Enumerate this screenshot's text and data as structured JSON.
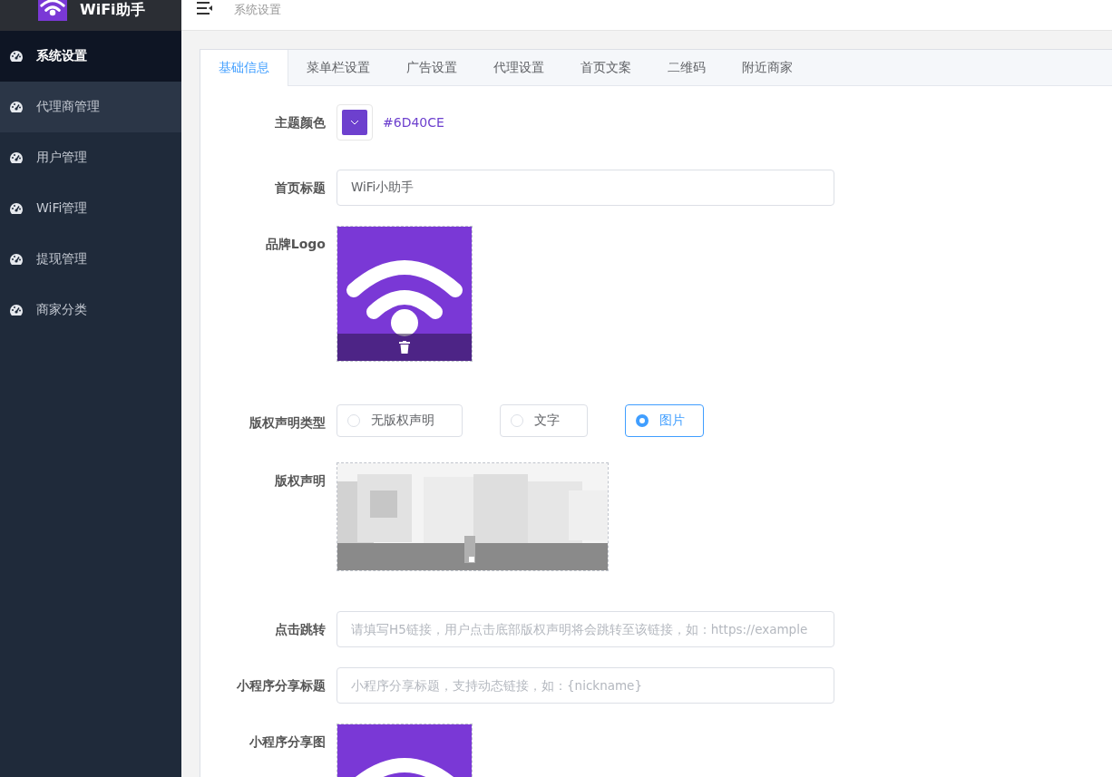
{
  "sidebar": {
    "brand": "WiFi助手",
    "items": [
      {
        "label": "系统设置",
        "selected": true,
        "hovered": false
      },
      {
        "label": "代理商管理",
        "selected": false,
        "hovered": true
      },
      {
        "label": "用户管理",
        "selected": false,
        "hovered": false
      },
      {
        "label": "WiFi管理",
        "selected": false,
        "hovered": false
      },
      {
        "label": "提现管理",
        "selected": false,
        "hovered": false
      },
      {
        "label": "商家分类",
        "selected": false,
        "hovered": false
      }
    ]
  },
  "breadcrumb": "系统设置",
  "tabs": [
    {
      "label": "基础信息",
      "selected": true
    },
    {
      "label": "菜单栏设置",
      "selected": false
    },
    {
      "label": "广告设置",
      "selected": false
    },
    {
      "label": "代理设置",
      "selected": false
    },
    {
      "label": "首页文案",
      "selected": false
    },
    {
      "label": "二维码",
      "selected": false
    },
    {
      "label": "附近商家",
      "selected": false
    }
  ],
  "form": [
    {
      "kind": "color",
      "label": "主题颜色",
      "value": "#6D40CE"
    },
    {
      "kind": "text",
      "label": "首页标题",
      "value": "WiFi小助手"
    },
    {
      "label": "品牌Logo",
      "delete_button": true
    },
    {
      "kind": "radio",
      "label": "版权声明类型",
      "options": [
        {
          "label": "无版权声明",
          "selected": false
        },
        {
          "label": "文字",
          "selected": false
        },
        {
          "label": "图片",
          "selected": true
        }
      ]
    },
    {
      "kind": "picture",
      "label": "版权声明"
    },
    {
      "kind": "input",
      "label": "点击跳转",
      "placeholder": "请填写H5链接，用户点击底部版权声明将会跳转至该链接，如：https://example"
    },
    {
      "kind": "input",
      "label": "小程序分享标题",
      "placeholder": "小程序分享标题，支持动态链接，如：{nickname}"
    },
    {
      "label": "小程序分享图"
    }
  ]
}
